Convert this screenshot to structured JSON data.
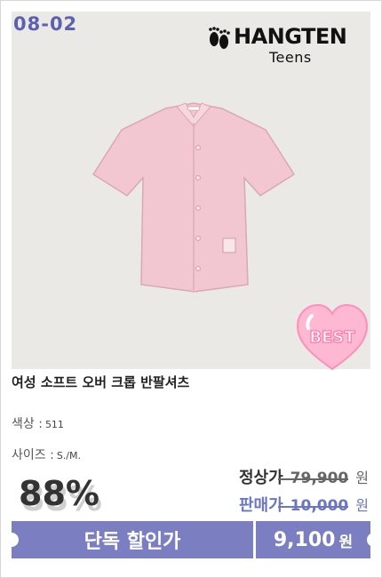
{
  "product": {
    "sku": "08-02",
    "brand": {
      "name": "HANGTEN",
      "line": "Teens",
      "logo_icon": "footprints-icon"
    },
    "badge": "BEST",
    "title": "여성 소프트 오버 크롭 반팔셔츠",
    "color_label": "색상 :",
    "color_value": "511",
    "size_label": "사이즈 :",
    "size_value": "S./M."
  },
  "pricing": {
    "discount": "88%",
    "regular_label": "정상가",
    "regular_price": "79,900",
    "sale_label": "판매가",
    "sale_price": "10,000",
    "currency": "원",
    "exclusive_label": "단독 할인가",
    "exclusive_price": "9,100"
  },
  "colors": {
    "accent": "#7b7fc2",
    "sku_text": "#5b61b0",
    "shirt": "#f2c7d1",
    "badge_heart": "#ffb8d2"
  }
}
